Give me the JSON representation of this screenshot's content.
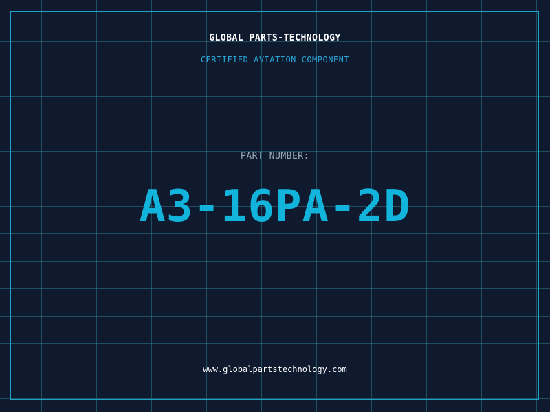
{
  "header": {
    "company": "GLOBAL PARTS-TECHNOLOGY",
    "subtitle": "CERTIFIED AVIATION COMPONENT"
  },
  "part": {
    "label": "PART NUMBER:",
    "number": "A3-16PA-2D"
  },
  "footer": {
    "website": "www.globalpartstechnology.com"
  },
  "colors": {
    "background": "#0f1a2e",
    "grid": "#28788c",
    "accent": "#12b4dc",
    "frame": "#1fa3c8"
  }
}
